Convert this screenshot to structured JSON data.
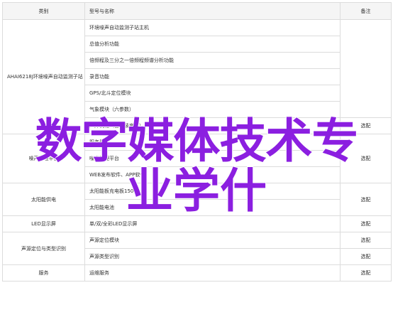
{
  "table": {
    "headers": [
      "类别",
      "型号与名称",
      "备注"
    ],
    "rows": [
      {
        "cat": "AHAI6218J环境噪声自动监测子站",
        "item": "环境噪声自动监测子站主机",
        "note": ""
      },
      {
        "cat": "",
        "item": "总值分析功能",
        "note": ""
      },
      {
        "cat": "",
        "item": "倍频程及三分之一倍频程频谱分析功能",
        "note": ""
      },
      {
        "cat": "",
        "item": "录音功能",
        "note": ""
      },
      {
        "cat": "",
        "item": "GPS/北斗定位模块",
        "note": ""
      },
      {
        "cat": "",
        "item": "气象模块（六参数）",
        "note": ""
      },
      {
        "cat": "",
        "item": "户外机柜（含安装底座）",
        "note": "选配"
      },
      {
        "cat": "噪声管理平台",
        "item": "服务器",
        "note": "选配"
      },
      {
        "cat": "",
        "item": "噪声管理平台",
        "note": ""
      },
      {
        "cat": "",
        "item": "WEB发布软件、APP软件",
        "note": ""
      },
      {
        "cat": "太阳能供电",
        "item": "太阳能板充电板150W",
        "note": "选配"
      },
      {
        "cat": "",
        "item": "太阳能电池",
        "note": ""
      },
      {
        "cat": "LED显示屏",
        "item": "单/双/全彩LED显示屏",
        "note": "选配"
      },
      {
        "cat": "声源定位与类型识别",
        "item": "声源定位模块",
        "note": "选配"
      },
      {
        "cat": "",
        "item": "声源类型识别",
        "note": "选配"
      },
      {
        "cat": "服务",
        "item": "运维服务",
        "note": "选配"
      }
    ]
  },
  "overlay": {
    "line1": "数字媒体技术专",
    "line2": "业学什"
  }
}
